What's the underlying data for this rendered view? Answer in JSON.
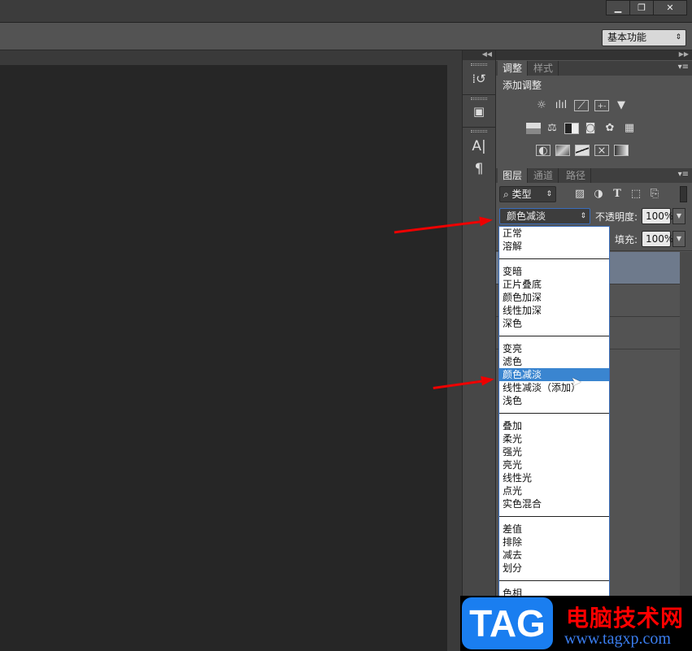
{
  "window": {
    "minimize": "▁",
    "restore": "❐",
    "close": "✕"
  },
  "options_bar": {
    "workspace": "基本功能"
  },
  "adjustments_panel": {
    "tabs": [
      "调整",
      "样式"
    ],
    "title": "添加调整",
    "icons": [
      [
        "brightness-icon",
        "levels-icon",
        "curves-icon",
        "exposure-icon",
        "vibrance-icon"
      ],
      [
        "hue-saturation-icon",
        "color-balance-icon",
        "black-white-icon",
        "photo-filter-icon",
        "channel-mixer-icon",
        "color-lookup-icon"
      ],
      [
        "invert-icon",
        "posterize-icon",
        "threshold-icon",
        "selective-color-icon",
        "gradient-map-icon"
      ]
    ]
  },
  "layers_panel": {
    "tabs": [
      "图层",
      "通道",
      "路径"
    ],
    "filter_kind": "类型",
    "blend_mode": "颜色减淡",
    "opacity_label": "不透明度:",
    "opacity": "100%",
    "fill_label": "填充:",
    "fill": "100%"
  },
  "blend_menu": {
    "groups": [
      [
        "正常",
        "溶解"
      ],
      [
        "变暗",
        "正片叠底",
        "颜色加深",
        "线性加深",
        "深色"
      ],
      [
        "变亮",
        "滤色",
        "颜色减淡",
        "线性减淡（添加）",
        "浅色"
      ],
      [
        "叠加",
        "柔光",
        "强光",
        "亮光",
        "线性光",
        "点光",
        "实色混合"
      ],
      [
        "差值",
        "排除",
        "减去",
        "划分"
      ],
      [
        "色相"
      ]
    ],
    "selected": "颜色减淡"
  },
  "watermark": {
    "logo": "TAG",
    "name": "电脑技术网",
    "url": "www.tagxp.com"
  },
  "colors": {
    "highlight": "#3a85d0",
    "arrow": "#e00000",
    "panel": "#535353"
  }
}
